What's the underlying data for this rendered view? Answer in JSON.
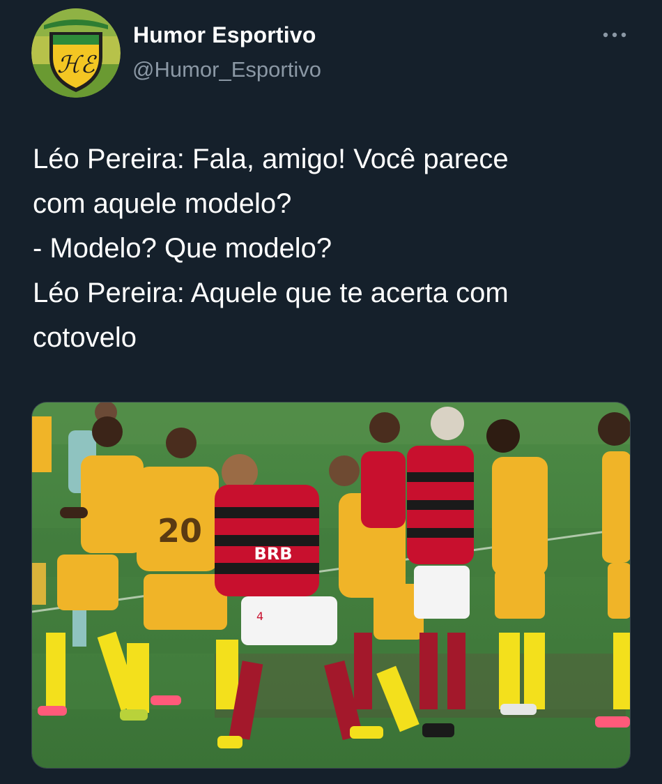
{
  "author": {
    "name": "Humor Esportivo",
    "handle": "@Humor_Esportivo",
    "avatar_icon": "shield-crest-icon"
  },
  "menu": {
    "icon": "more-horizontal-icon"
  },
  "tweet": {
    "lines": [
      "Léo Pereira: Fala, amigo! Você parece",
      "com aquele modelo?",
      "- Modelo? Que modelo?",
      "Léo Pereira: Aquele que te acerta com",
      "cotovelo"
    ]
  },
  "media": {
    "kind": "photo",
    "jersey_numbers": [
      "20",
      "4"
    ],
    "sponsor_text": "BRB"
  },
  "colors": {
    "background": "#15202b",
    "text": "#ffffff",
    "secondary_text": "#8b98a5",
    "pitch": "#3f7a3b",
    "yellow_kit": "#f0b428",
    "red_kit": "#c8102e"
  }
}
